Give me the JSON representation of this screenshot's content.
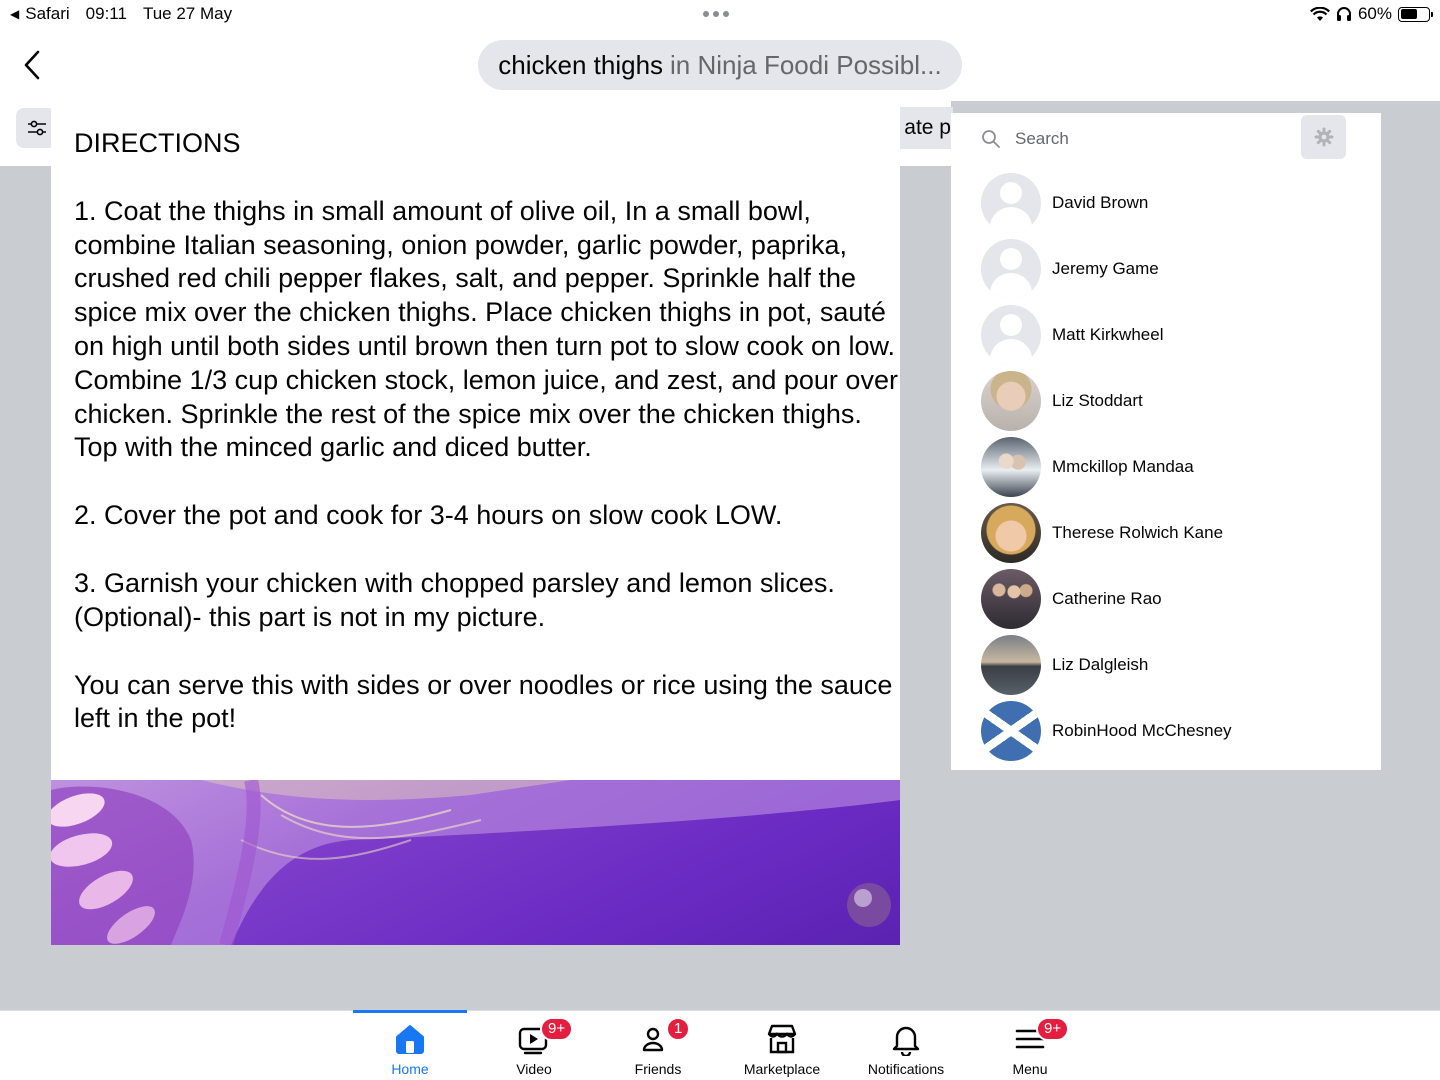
{
  "status_bar": {
    "back_app": "Safari",
    "time": "09:11",
    "date": "Tue 27 May",
    "battery_percent": "60%",
    "battery_level": 0.6
  },
  "search": {
    "query": "chicken thighs",
    "scope": "in Ninja Foodi Possibl..."
  },
  "filter_chip": "ate p",
  "post": {
    "heading": "DIRECTIONS",
    "paragraphs": [
      "1. Coat the thighs in small amount of olive oil, In a small bowl, combine Italian seasoning, onion powder, garlic powder, paprika, crushed red chili pepper flakes, salt, and pepper. Sprinkle half the spice mix over the chicken thighs. Place chicken thighs in pot, sauté on high until both sides until brown then turn pot to slow cook on low. Combine 1/3 cup chicken stock, lemon juice, and zest, and pour over chicken. Sprinkle the rest of the spice mix over the chicken thighs. Top with the minced garlic and diced butter.",
      "2. Cover the pot and cook for 3-4 hours on slow cook LOW.",
      "3. Garnish your chicken with chopped parsley and lemon slices. (Optional)- this part is not in my picture.",
      "You can serve this with sides or over noodles or rice using the sauce left in the pot!"
    ]
  },
  "contacts": {
    "search_placeholder": "Search",
    "items": [
      {
        "name": "David Brown",
        "avatar": "default"
      },
      {
        "name": "Jeremy Game",
        "avatar": "default"
      },
      {
        "name": "Matt Kirkwheel",
        "avatar": "default"
      },
      {
        "name": "Liz Stoddart",
        "avatar": "photo"
      },
      {
        "name": "Mmckillop Mandaa",
        "avatar": "photo"
      },
      {
        "name": "Therese Rolwich Kane",
        "avatar": "photo"
      },
      {
        "name": "Catherine Rao",
        "avatar": "photo"
      },
      {
        "name": "Liz Dalgleish",
        "avatar": "photo"
      },
      {
        "name": "RobinHood McChesney",
        "avatar": "photo"
      }
    ]
  },
  "bottom_nav": {
    "tabs": [
      {
        "label": "Home",
        "icon": "home-icon",
        "active": true,
        "badge": ""
      },
      {
        "label": "Video",
        "icon": "video-icon",
        "active": false,
        "badge": "9+"
      },
      {
        "label": "Friends",
        "icon": "friends-icon",
        "active": false,
        "badge": "1"
      },
      {
        "label": "Marketplace",
        "icon": "marketplace-icon",
        "active": false,
        "badge": ""
      },
      {
        "label": "Notifications",
        "icon": "bell-icon",
        "active": false,
        "badge": ""
      },
      {
        "label": "Menu",
        "icon": "menu-icon",
        "active": false,
        "badge": "9+"
      }
    ]
  },
  "colors": {
    "accent": "#1877f2",
    "badge": "#e41e3f",
    "feed_background": "#c9ccd1",
    "secondary_text": "#65676b"
  }
}
